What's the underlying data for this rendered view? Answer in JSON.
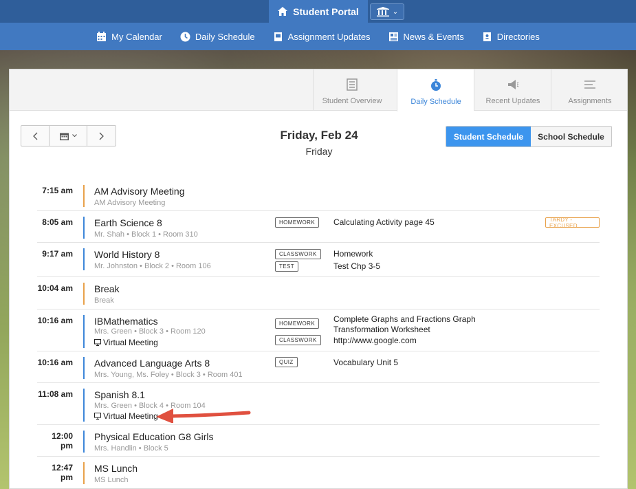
{
  "portal": {
    "title": "Student Portal"
  },
  "nav": [
    {
      "label": "My Calendar",
      "icon": "calendar-icon"
    },
    {
      "label": "Daily Schedule",
      "icon": "clock-icon"
    },
    {
      "label": "Assignment Updates",
      "icon": "assignment-icon"
    },
    {
      "label": "News & Events",
      "icon": "news-icon"
    },
    {
      "label": "Directories",
      "icon": "directory-icon"
    }
  ],
  "tabs": [
    {
      "label": "Student Overview",
      "icon": "checklist-icon"
    },
    {
      "label": "Daily Schedule",
      "icon": "stopwatch-icon"
    },
    {
      "label": "Recent Updates",
      "icon": "megaphone-icon"
    },
    {
      "label": "Assignments",
      "icon": "lines-icon"
    }
  ],
  "date": {
    "title": "Friday, Feb 24",
    "subtitle": "Friday"
  },
  "toggle": {
    "student": "Student Schedule",
    "school": "School Schedule"
  },
  "colors": {
    "accent": "#3c95ee",
    "nav": "#4179c1",
    "orange": "#e8a14a",
    "blue": "#3c86d9"
  },
  "schedule": [
    {
      "time": "7:15 am",
      "title": "AM Advisory Meeting",
      "sub": "AM Advisory Meeting",
      "bar": "orange"
    },
    {
      "time": "8:05 am",
      "title": "Earth Science 8",
      "sub": "Mr. Shah • Block 1 • Room 310",
      "bar": "blue",
      "tags": [
        "HOMEWORK"
      ],
      "assign": [
        "Calculating Activity page 45"
      ],
      "badge": "TARDY - EXCUSED"
    },
    {
      "time": "9:17 am",
      "title": "World History 8",
      "sub": "Mr. Johnston • Block 2 • Room 106",
      "bar": "blue",
      "tags": [
        "CLASSWORK",
        "TEST"
      ],
      "assign": [
        "Homework",
        "Test Chp 3-5"
      ]
    },
    {
      "time": "10:04 am",
      "title": "Break",
      "sub": "Break",
      "bar": "orange"
    },
    {
      "time": "10:16 am",
      "title": "IBMathematics",
      "sub": "Mrs. Green • Block 3 • Room 120",
      "bar": "blue",
      "virtual": "Virtual Meeting",
      "tags": [
        "HOMEWORK",
        "CLASSWORK"
      ],
      "assign": [
        "Complete Graphs and Fractions Graph",
        "Transformation Worksheet",
        "http://www.google.com"
      ]
    },
    {
      "time": "10:16 am",
      "title": "Advanced Language Arts 8",
      "sub": "Mrs. Young, Ms. Foley • Block 3 • Room 401",
      "bar": "blue",
      "tags": [
        "QUIZ"
      ],
      "assign": [
        "Vocabulary Unit 5"
      ]
    },
    {
      "time": "11:08 am",
      "title": "Spanish 8.1",
      "sub": "Mrs. Green • Block 4 • Room 104",
      "bar": "blue",
      "virtual": "Virtual Meeting"
    },
    {
      "time": "12:00 pm",
      "title": "Physical Education G8 Girls",
      "sub": "Mrs. Handlin • Block 5",
      "bar": "blue"
    },
    {
      "time": "12:47 pm",
      "title": "MS Lunch",
      "sub": "MS Lunch",
      "bar": "orange"
    }
  ]
}
